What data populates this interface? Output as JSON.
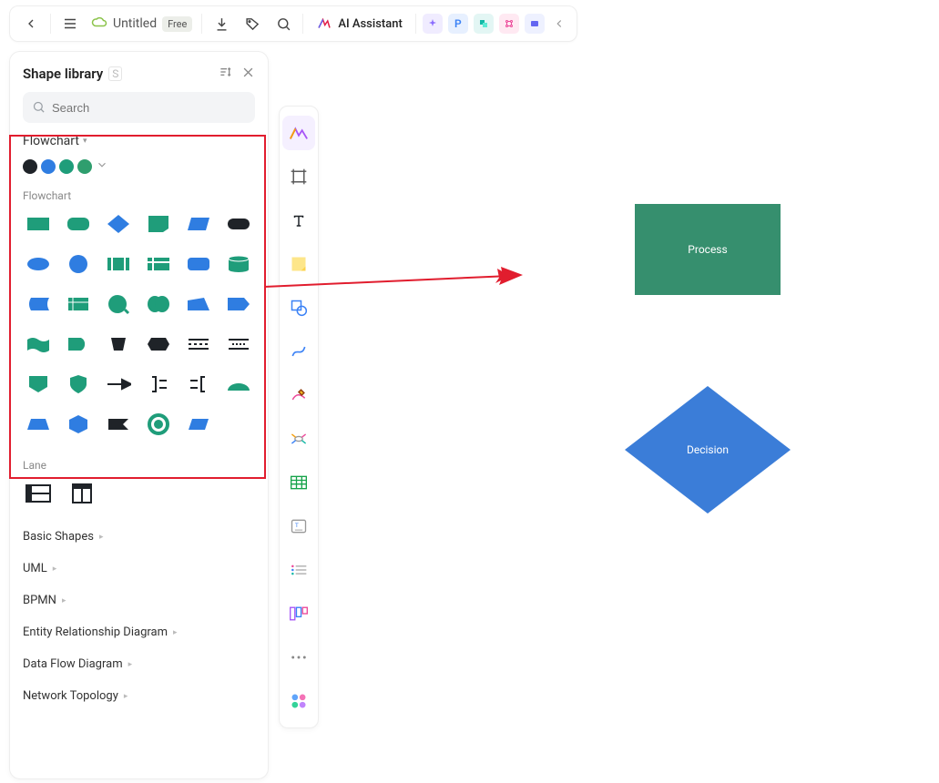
{
  "toolbar": {
    "doc_title": "Untitled",
    "badge": "Free",
    "ai_label": "AI Assistant",
    "chip_p": "P"
  },
  "panel": {
    "title": "Shape library",
    "shortcut": "S",
    "search_placeholder": "Search",
    "category_active": "Flowchart",
    "colors": [
      "#1f2328",
      "#2f7de1",
      "#1f9d7a",
      "#2f9e6e"
    ],
    "section_flowchart": "Flowchart",
    "section_lane": "Lane",
    "other_categories": [
      "Basic Shapes",
      "UML",
      "BPMN",
      "Entity Relationship Diagram",
      "Data Flow Diagram",
      "Network Topology"
    ]
  },
  "canvas": {
    "process_label": "Process",
    "decision_label": "Decision"
  },
  "shapes": {
    "flowchart_names": [
      "rectangle",
      "rounded-rectangle",
      "diamond",
      "note",
      "parallelogram",
      "terminator",
      "ellipse",
      "circle",
      "predefined-process",
      "internal-storage",
      "rounded-rect-alt",
      "cylinder",
      "barrel-left",
      "list",
      "lens",
      "lens-pair",
      "trapezoid-right",
      "tab-right",
      "wave",
      "d-shape",
      "bucket",
      "hexagon-flat",
      "triple-line",
      "triple-line-gap",
      "pentagon-down",
      "shield",
      "arrow-right-line",
      "brackets-right",
      "brackets-left",
      "half-moon",
      "trapezoid",
      "hexagon",
      "flag",
      "ring",
      "parallelogram-small",
      "blank"
    ]
  }
}
